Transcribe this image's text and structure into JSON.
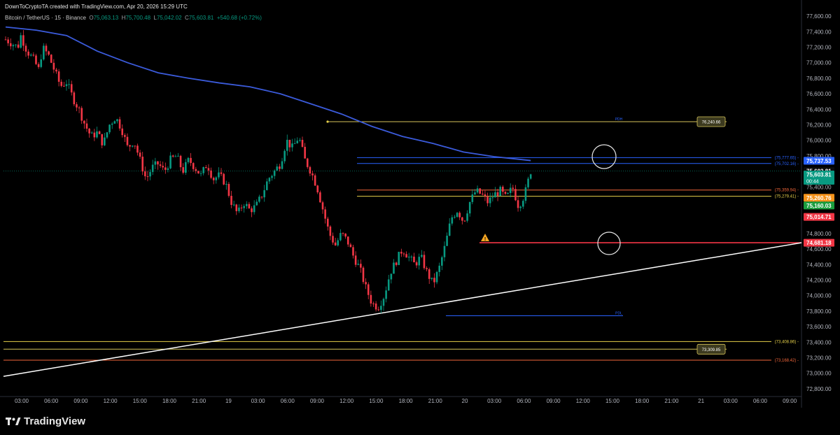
{
  "header": {
    "attribution": "DownToCryptoTA created with TradingView.com, Apr 20, 2026 15:29 UTC"
  },
  "legend": {
    "symbol": "Bitcoin / TetherUS · 15 · Binance",
    "o_label": "O",
    "o": "75,063.13",
    "h_label": "H",
    "h": "75,700.48",
    "l_label": "L",
    "l": "75,042.02",
    "c_label": "C",
    "c": "75,603.81",
    "change": "+540.68 (+0.72%)"
  },
  "chart_data": {
    "type": "candlestick",
    "symbol": "Bitcoin / TetherUS",
    "interval": "15",
    "exchange": "Binance",
    "ylim": [
      72700,
      77700
    ],
    "yticks": [
      72800,
      73000,
      73200,
      73400,
      73600,
      73800,
      74000,
      74200,
      74400,
      74600,
      74800,
      75000,
      75200,
      75400,
      75600,
      75800,
      76000,
      76200,
      76400,
      76600,
      76800,
      77000,
      77200,
      77400,
      77600
    ],
    "ytick_labels": [
      "72,800.00",
      "73,000.00",
      "73,200.00",
      "73,400.00",
      "73,600.00",
      "73,800.00",
      "74,000.00",
      "74,200.00",
      "74,400.00",
      "74,600.00",
      "74,800.00",
      "75,000.00",
      "75,200.00",
      "75,400.00",
      "75,600.00",
      "75,800.00",
      "76,000.00",
      "76,200.00",
      "76,400.00",
      "76,600.00",
      "76,800.00",
      "77,000.00",
      "77,200.00",
      "77,400.00",
      "77,600.00"
    ],
    "xticks": [
      "03:00",
      "06:00",
      "09:00",
      "12:00",
      "15:00",
      "18:00",
      "21:00",
      "19",
      "03:00",
      "06:00",
      "09:00",
      "12:00",
      "15:00",
      "18:00",
      "21:00",
      "20",
      "03:00",
      "06:00",
      "09:00",
      "12:00",
      "15:00",
      "18:00",
      "21:00",
      "21",
      "03:00",
      "06:00",
      "09:00"
    ],
    "close_path": [
      [
        0,
        77300
      ],
      [
        2,
        77250
      ],
      [
        4,
        77200
      ],
      [
        5,
        77350
      ],
      [
        7,
        77150
      ],
      [
        9,
        77050
      ],
      [
        11,
        76900
      ],
      [
        12,
        77200
      ],
      [
        14,
        77100
      ],
      [
        16,
        76900
      ],
      [
        18,
        76700
      ],
      [
        20,
        76750
      ],
      [
        22,
        76550
      ],
      [
        24,
        76400
      ],
      [
        26,
        76200
      ],
      [
        28,
        76050
      ],
      [
        30,
        76100
      ],
      [
        32,
        75950
      ],
      [
        34,
        76200
      ],
      [
        36,
        76300
      ],
      [
        38,
        76150
      ],
      [
        40,
        75900
      ],
      [
        42,
        76000
      ],
      [
        44,
        75750
      ],
      [
        46,
        75500
      ],
      [
        48,
        75650
      ],
      [
        50,
        75700
      ],
      [
        52,
        75600
      ],
      [
        54,
        75750
      ],
      [
        56,
        75800
      ],
      [
        58,
        75600
      ],
      [
        60,
        75750
      ],
      [
        62,
        75650
      ],
      [
        64,
        75550
      ],
      [
        66,
        75700
      ],
      [
        68,
        75500
      ],
      [
        70,
        75550
      ],
      [
        72,
        75450
      ],
      [
        74,
        75200
      ],
      [
        76,
        75050
      ],
      [
        78,
        75200
      ],
      [
        80,
        75100
      ],
      [
        82,
        75150
      ],
      [
        84,
        75300
      ],
      [
        86,
        75500
      ],
      [
        88,
        75600
      ],
      [
        90,
        75700
      ],
      [
        92,
        76000
      ],
      [
        94,
        75900
      ],
      [
        96,
        76050
      ],
      [
        98,
        75750
      ],
      [
        100,
        75600
      ],
      [
        102,
        75400
      ],
      [
        104,
        75100
      ],
      [
        106,
        74800
      ],
      [
        108,
        74650
      ],
      [
        110,
        74800
      ],
      [
        112,
        74700
      ],
      [
        114,
        74500
      ],
      [
        116,
        74350
      ],
      [
        118,
        74100
      ],
      [
        120,
        73900
      ],
      [
        122,
        73850
      ],
      [
        124,
        74000
      ],
      [
        126,
        74300
      ],
      [
        128,
        74450
      ],
      [
        130,
        74600
      ],
      [
        132,
        74500
      ],
      [
        134,
        74400
      ],
      [
        136,
        74500
      ],
      [
        138,
        74300
      ],
      [
        140,
        74150
      ],
      [
        142,
        74350
      ],
      [
        144,
        74650
      ],
      [
        146,
        75000
      ],
      [
        148,
        75100
      ],
      [
        150,
        74950
      ],
      [
        152,
        75200
      ],
      [
        154,
        75350
      ],
      [
        156,
        75300
      ],
      [
        158,
        75200
      ],
      [
        160,
        75300
      ],
      [
        162,
        75350
      ],
      [
        164,
        75250
      ],
      [
        166,
        75400
      ],
      [
        168,
        75150
      ],
      [
        170,
        75300
      ],
      [
        172,
        75603.81
      ]
    ],
    "vwap_path": [
      [
        0,
        77460
      ],
      [
        10,
        77420
      ],
      [
        20,
        77350
      ],
      [
        30,
        77150
      ],
      [
        40,
        77000
      ],
      [
        50,
        76870
      ],
      [
        60,
        76800
      ],
      [
        70,
        76740
      ],
      [
        80,
        76690
      ],
      [
        90,
        76600
      ],
      [
        100,
        76470
      ],
      [
        110,
        76340
      ],
      [
        120,
        76180
      ],
      [
        130,
        76050
      ],
      [
        140,
        75960
      ],
      [
        150,
        75850
      ],
      [
        160,
        75790
      ],
      [
        172,
        75740
      ]
    ],
    "levels": [
      {
        "name": "PDH",
        "value": 76240.66,
        "label": "76,240.66",
        "color": "#d6c55a"
      },
      {
        "name": "",
        "value": 75777.65,
        "label": "(75,777.65)",
        "color": "#2962ff"
      },
      {
        "name": "",
        "value": 75702.16,
        "label": "(75,702.16)",
        "color": "#2962ff"
      },
      {
        "name": "",
        "value": 75359.94,
        "label": "(75,359.94)",
        "color": "#f2663a"
      },
      {
        "name": "",
        "value": 75279.41,
        "label": "(75,279.41)",
        "color": "#e6d04a"
      },
      {
        "name": "PDL",
        "value": 73740,
        "label": "",
        "color": "#2962ff"
      },
      {
        "name": "",
        "value": 73408.86,
        "label": "(73,408.86)",
        "color": "#e6d04a"
      },
      {
        "name": "",
        "value": 73309.85,
        "label": "73,309.85",
        "color": "#d6c55a"
      },
      {
        "name": "",
        "value": 73168.42,
        "label": "(73,168.42)",
        "color": "#f2663a"
      },
      {
        "name": "",
        "value": 74681.18,
        "label": "74,681.18",
        "color": "#f23645"
      }
    ],
    "trendline": [
      [
        72960,
        0
      ],
      [
        74681.18,
        1
      ]
    ],
    "price_tags": [
      {
        "value": 75737.53,
        "label": "75,737.53",
        "color": "#2962ff"
      },
      {
        "value": 75603.81,
        "label": "75,603.81",
        "color": "#0c0c0c"
      },
      {
        "value": 75560,
        "label": "75,603.81",
        "sublabel": "00:44",
        "color": "#089981"
      },
      {
        "value": 75260.76,
        "label": "75,260.76",
        "color": "#f7931a"
      },
      {
        "value": 75160.03,
        "label": "75,160.03",
        "color": "#1b9e3e"
      },
      {
        "value": 75014.71,
        "label": "75,014.71",
        "color": "#f23645"
      },
      {
        "value": 74681.18,
        "label": "74,681.18",
        "color": "#f23645"
      }
    ]
  },
  "footer": {
    "brand": "TradingView"
  },
  "colors": {
    "up": "#089981",
    "down": "#f23645",
    "vwap": "#3b5bdb",
    "background": "#000000"
  }
}
